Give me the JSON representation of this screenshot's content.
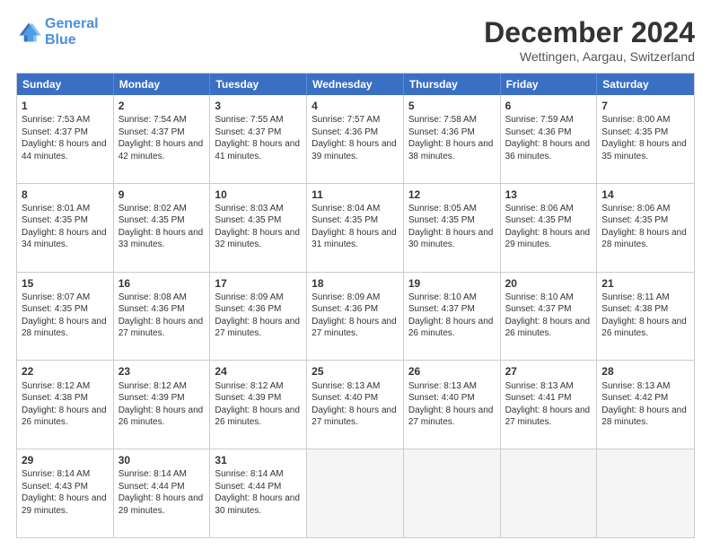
{
  "logo": {
    "line1": "General",
    "line2": "Blue"
  },
  "title": "December 2024",
  "location": "Wettingen, Aargau, Switzerland",
  "header_days": [
    "Sunday",
    "Monday",
    "Tuesday",
    "Wednesday",
    "Thursday",
    "Friday",
    "Saturday"
  ],
  "weeks": [
    [
      {
        "day": "1",
        "sunrise": "Sunrise: 7:53 AM",
        "sunset": "Sunset: 4:37 PM",
        "daylight": "Daylight: 8 hours and 44 minutes."
      },
      {
        "day": "2",
        "sunrise": "Sunrise: 7:54 AM",
        "sunset": "Sunset: 4:37 PM",
        "daylight": "Daylight: 8 hours and 42 minutes."
      },
      {
        "day": "3",
        "sunrise": "Sunrise: 7:55 AM",
        "sunset": "Sunset: 4:37 PM",
        "daylight": "Daylight: 8 hours and 41 minutes."
      },
      {
        "day": "4",
        "sunrise": "Sunrise: 7:57 AM",
        "sunset": "Sunset: 4:36 PM",
        "daylight": "Daylight: 8 hours and 39 minutes."
      },
      {
        "day": "5",
        "sunrise": "Sunrise: 7:58 AM",
        "sunset": "Sunset: 4:36 PM",
        "daylight": "Daylight: 8 hours and 38 minutes."
      },
      {
        "day": "6",
        "sunrise": "Sunrise: 7:59 AM",
        "sunset": "Sunset: 4:36 PM",
        "daylight": "Daylight: 8 hours and 36 minutes."
      },
      {
        "day": "7",
        "sunrise": "Sunrise: 8:00 AM",
        "sunset": "Sunset: 4:35 PM",
        "daylight": "Daylight: 8 hours and 35 minutes."
      }
    ],
    [
      {
        "day": "8",
        "sunrise": "Sunrise: 8:01 AM",
        "sunset": "Sunset: 4:35 PM",
        "daylight": "Daylight: 8 hours and 34 minutes."
      },
      {
        "day": "9",
        "sunrise": "Sunrise: 8:02 AM",
        "sunset": "Sunset: 4:35 PM",
        "daylight": "Daylight: 8 hours and 33 minutes."
      },
      {
        "day": "10",
        "sunrise": "Sunrise: 8:03 AM",
        "sunset": "Sunset: 4:35 PM",
        "daylight": "Daylight: 8 hours and 32 minutes."
      },
      {
        "day": "11",
        "sunrise": "Sunrise: 8:04 AM",
        "sunset": "Sunset: 4:35 PM",
        "daylight": "Daylight: 8 hours and 31 minutes."
      },
      {
        "day": "12",
        "sunrise": "Sunrise: 8:05 AM",
        "sunset": "Sunset: 4:35 PM",
        "daylight": "Daylight: 8 hours and 30 minutes."
      },
      {
        "day": "13",
        "sunrise": "Sunrise: 8:06 AM",
        "sunset": "Sunset: 4:35 PM",
        "daylight": "Daylight: 8 hours and 29 minutes."
      },
      {
        "day": "14",
        "sunrise": "Sunrise: 8:06 AM",
        "sunset": "Sunset: 4:35 PM",
        "daylight": "Daylight: 8 hours and 28 minutes."
      }
    ],
    [
      {
        "day": "15",
        "sunrise": "Sunrise: 8:07 AM",
        "sunset": "Sunset: 4:35 PM",
        "daylight": "Daylight: 8 hours and 28 minutes."
      },
      {
        "day": "16",
        "sunrise": "Sunrise: 8:08 AM",
        "sunset": "Sunset: 4:36 PM",
        "daylight": "Daylight: 8 hours and 27 minutes."
      },
      {
        "day": "17",
        "sunrise": "Sunrise: 8:09 AM",
        "sunset": "Sunset: 4:36 PM",
        "daylight": "Daylight: 8 hours and 27 minutes."
      },
      {
        "day": "18",
        "sunrise": "Sunrise: 8:09 AM",
        "sunset": "Sunset: 4:36 PM",
        "daylight": "Daylight: 8 hours and 27 minutes."
      },
      {
        "day": "19",
        "sunrise": "Sunrise: 8:10 AM",
        "sunset": "Sunset: 4:37 PM",
        "daylight": "Daylight: 8 hours and 26 minutes."
      },
      {
        "day": "20",
        "sunrise": "Sunrise: 8:10 AM",
        "sunset": "Sunset: 4:37 PM",
        "daylight": "Daylight: 8 hours and 26 minutes."
      },
      {
        "day": "21",
        "sunrise": "Sunrise: 8:11 AM",
        "sunset": "Sunset: 4:38 PM",
        "daylight": "Daylight: 8 hours and 26 minutes."
      }
    ],
    [
      {
        "day": "22",
        "sunrise": "Sunrise: 8:12 AM",
        "sunset": "Sunset: 4:38 PM",
        "daylight": "Daylight: 8 hours and 26 minutes."
      },
      {
        "day": "23",
        "sunrise": "Sunrise: 8:12 AM",
        "sunset": "Sunset: 4:39 PM",
        "daylight": "Daylight: 8 hours and 26 minutes."
      },
      {
        "day": "24",
        "sunrise": "Sunrise: 8:12 AM",
        "sunset": "Sunset: 4:39 PM",
        "daylight": "Daylight: 8 hours and 26 minutes."
      },
      {
        "day": "25",
        "sunrise": "Sunrise: 8:13 AM",
        "sunset": "Sunset: 4:40 PM",
        "daylight": "Daylight: 8 hours and 27 minutes."
      },
      {
        "day": "26",
        "sunrise": "Sunrise: 8:13 AM",
        "sunset": "Sunset: 4:40 PM",
        "daylight": "Daylight: 8 hours and 27 minutes."
      },
      {
        "day": "27",
        "sunrise": "Sunrise: 8:13 AM",
        "sunset": "Sunset: 4:41 PM",
        "daylight": "Daylight: 8 hours and 27 minutes."
      },
      {
        "day": "28",
        "sunrise": "Sunrise: 8:13 AM",
        "sunset": "Sunset: 4:42 PM",
        "daylight": "Daylight: 8 hours and 28 minutes."
      }
    ],
    [
      {
        "day": "29",
        "sunrise": "Sunrise: 8:14 AM",
        "sunset": "Sunset: 4:43 PM",
        "daylight": "Daylight: 8 hours and 29 minutes."
      },
      {
        "day": "30",
        "sunrise": "Sunrise: 8:14 AM",
        "sunset": "Sunset: 4:44 PM",
        "daylight": "Daylight: 8 hours and 29 minutes."
      },
      {
        "day": "31",
        "sunrise": "Sunrise: 8:14 AM",
        "sunset": "Sunset: 4:44 PM",
        "daylight": "Daylight: 8 hours and 30 minutes."
      },
      null,
      null,
      null,
      null
    ]
  ]
}
